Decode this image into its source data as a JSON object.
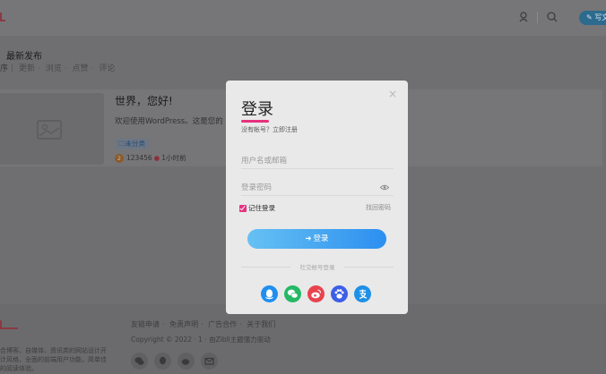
{
  "colors": {
    "accent": "#e6317e",
    "button_start": "#66c1f2",
    "button_end": "#2c8ff0",
    "qq": "#1f8ff0",
    "wechat": "#25b865",
    "weibo": "#e8434d",
    "baidu": "#3d5ee6",
    "alipay": "#1e90e6"
  },
  "header": {
    "write_label": "写文"
  },
  "main": {
    "section_title": "最新发布",
    "sort": {
      "prefix": "序",
      "options": [
        "更新",
        "浏览",
        "点赞",
        "评论"
      ]
    },
    "post": {
      "title": "世界，您好!",
      "excerpt": "欢迎使用WordPress。这是您的",
      "category": "未分类",
      "author_badge": "2",
      "author": "123456",
      "time": "1小时前"
    }
  },
  "footer": {
    "links": [
      "友链申请",
      "免责声明",
      "广告合作",
      "关于我们"
    ],
    "copyright": "Copyright © 2022 · 1 · 由Zibll主题强力驱动",
    "description": "合博客、自媒体、资讯类的网站设计开计风格，全面的前端用户功能，简单佳的阅读体验。"
  },
  "modal": {
    "title": "登录",
    "no_account": "没有帐号？",
    "register": "立即注册",
    "username_placeholder": "用户名或邮箱",
    "password_placeholder": "登录密码",
    "remember": "记住登录",
    "forgot": "找回密码",
    "login_button": "登录",
    "social_label": "社交帐号登录",
    "close": "×",
    "social_icons": [
      "qq-icon",
      "wechat-icon",
      "weibo-icon",
      "baidu-icon",
      "alipay-icon"
    ]
  }
}
